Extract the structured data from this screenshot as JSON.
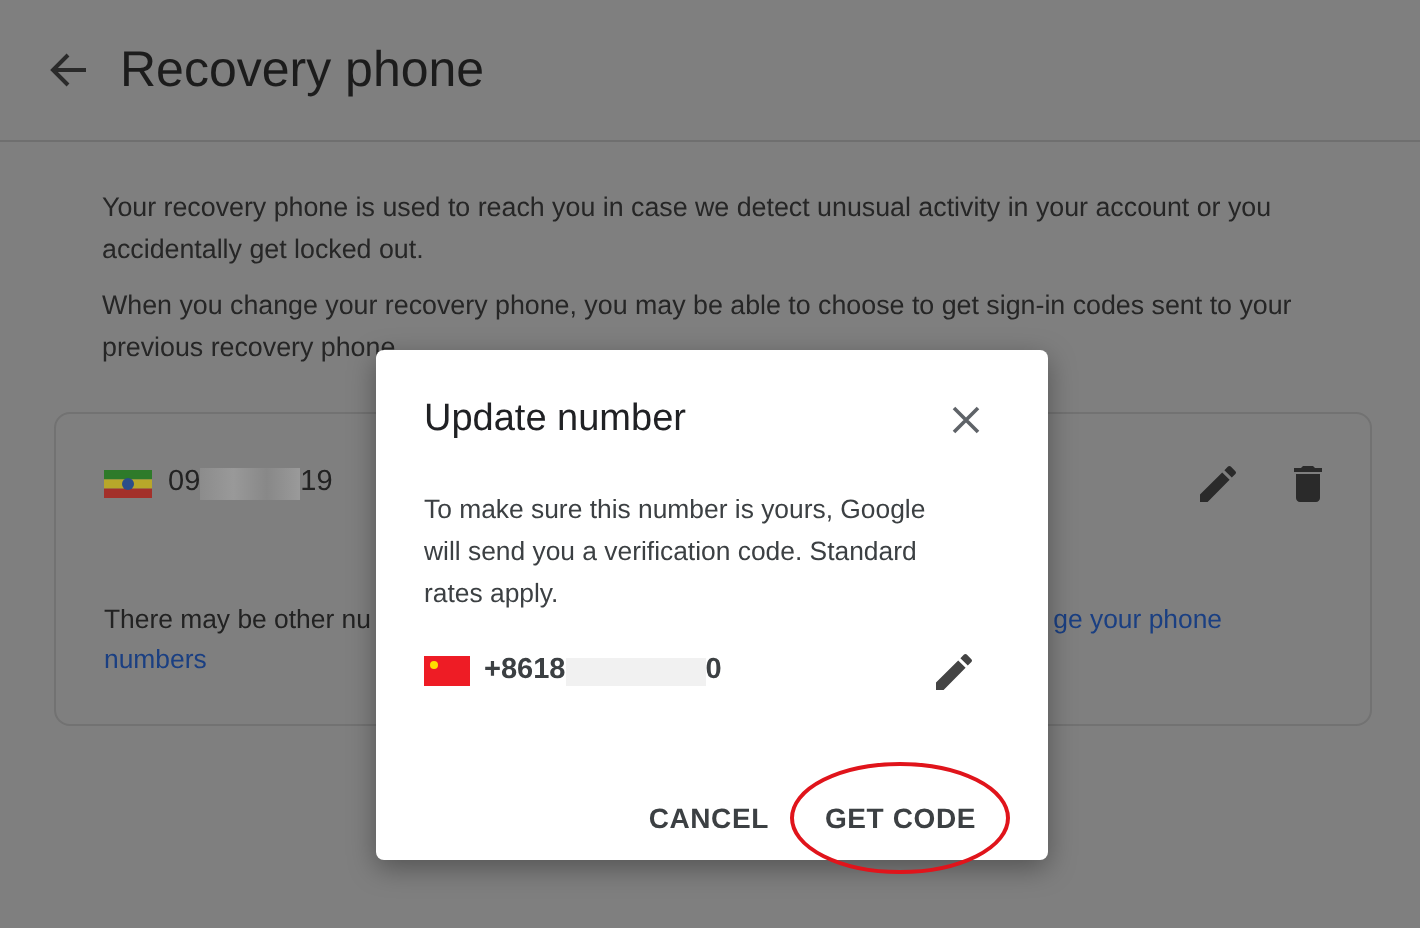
{
  "header": {
    "title": "Recovery phone"
  },
  "intro": [
    "Your recovery phone is used to reach you in case we detect unusual activity in your account or you accidentally get locked out.",
    "When you change your recovery phone, you may be able to choose to get sign-in codes sent to your previous recovery phone"
  ],
  "phone_card": {
    "number_start": "09",
    "number_end": "19",
    "note": "There may be other nu",
    "link_parts": [
      "ge your phone",
      "numbers"
    ]
  },
  "dialog": {
    "title": "Update number",
    "message": "To make sure this number is yours, Google will send you a verification code. Standard rates apply.",
    "number_start": "+8618",
    "number_end": "0",
    "buttons": [
      {
        "label": "CANCEL",
        "circled": false
      },
      {
        "label": "GET CODE",
        "circled": true
      }
    ]
  }
}
